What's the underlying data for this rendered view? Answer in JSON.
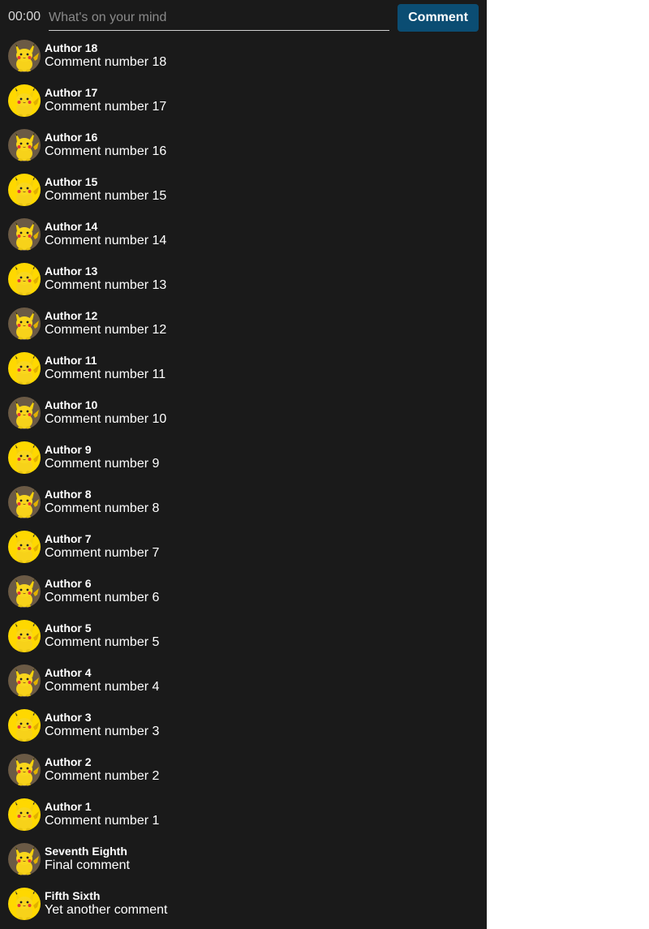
{
  "composer": {
    "timer": "00:00",
    "placeholder": "What's on your mind",
    "value": "",
    "button_label": "Comment"
  },
  "colors": {
    "panel_bg": "#1a1a1a",
    "button_bg": "#0b4d73",
    "avatar_bg_a": "#6b5a45",
    "avatar_bg_b": "#ffd800"
  },
  "comments": [
    {
      "author": "Author 18",
      "text": "Comment number 18",
      "avatar": "pikachu-icon"
    },
    {
      "author": "Author 17",
      "text": "Comment number 17",
      "avatar": "pikachu-icon"
    },
    {
      "author": "Author 16",
      "text": "Comment number 16",
      "avatar": "pikachu-icon"
    },
    {
      "author": "Author 15",
      "text": "Comment number 15",
      "avatar": "pikachu-icon"
    },
    {
      "author": "Author 14",
      "text": "Comment number 14",
      "avatar": "pikachu-icon"
    },
    {
      "author": "Author 13",
      "text": "Comment number 13",
      "avatar": "pikachu-icon"
    },
    {
      "author": "Author 12",
      "text": "Comment number 12",
      "avatar": "pikachu-icon"
    },
    {
      "author": "Author 11",
      "text": "Comment number 11",
      "avatar": "pikachu-icon"
    },
    {
      "author": "Author 10",
      "text": "Comment number 10",
      "avatar": "pikachu-icon"
    },
    {
      "author": "Author 9",
      "text": "Comment number 9",
      "avatar": "pikachu-icon"
    },
    {
      "author": "Author 8",
      "text": "Comment number 8",
      "avatar": "pikachu-icon"
    },
    {
      "author": "Author 7",
      "text": "Comment number 7",
      "avatar": "pikachu-icon"
    },
    {
      "author": "Author 6",
      "text": "Comment number 6",
      "avatar": "pikachu-icon"
    },
    {
      "author": "Author 5",
      "text": "Comment number 5",
      "avatar": "pikachu-icon"
    },
    {
      "author": "Author 4",
      "text": "Comment number 4",
      "avatar": "pikachu-icon"
    },
    {
      "author": "Author 3",
      "text": "Comment number 3",
      "avatar": "pikachu-icon"
    },
    {
      "author": "Author 2",
      "text": "Comment number 2",
      "avatar": "pikachu-icon"
    },
    {
      "author": "Author 1",
      "text": "Comment number 1",
      "avatar": "pikachu-icon"
    },
    {
      "author": "Seventh Eighth",
      "text": "Final comment",
      "avatar": "pikachu-icon"
    },
    {
      "author": "Fifth Sixth",
      "text": "Yet another comment",
      "avatar": "pikachu-icon"
    }
  ]
}
